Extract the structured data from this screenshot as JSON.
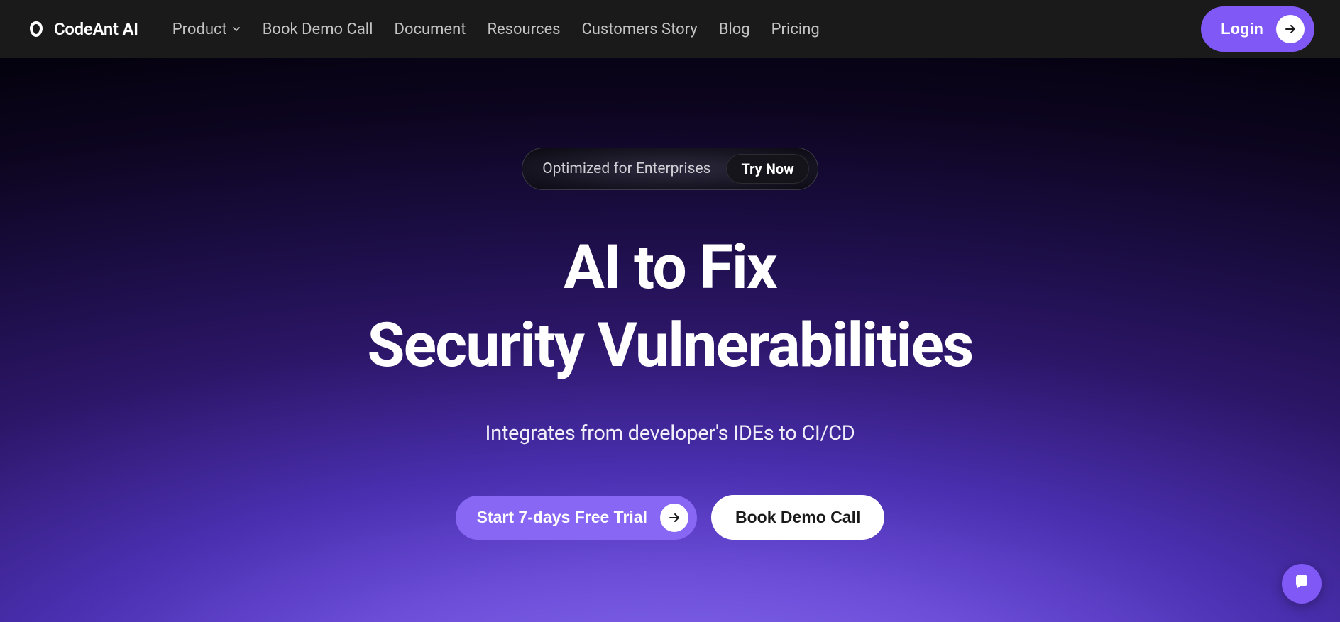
{
  "brand": {
    "name": "CodeAnt AI"
  },
  "nav": {
    "items": [
      {
        "label": "Product",
        "hasDropdown": true
      },
      {
        "label": "Book Demo Call",
        "hasDropdown": false
      },
      {
        "label": "Document",
        "hasDropdown": false
      },
      {
        "label": "Resources",
        "hasDropdown": false
      },
      {
        "label": "Customers Story",
        "hasDropdown": false
      },
      {
        "label": "Blog",
        "hasDropdown": false
      },
      {
        "label": "Pricing",
        "hasDropdown": false
      }
    ],
    "login_label": "Login"
  },
  "hero": {
    "pill_text": "Optimized for Enterprises",
    "pill_cta": "Try Now",
    "headline_line1": "AI to Fix",
    "headline_line2": "Security Vulnerabilities",
    "subhead": "Integrates from developer's IDEs to CI/CD",
    "cta_primary": "Start 7-days Free Trial",
    "cta_secondary": "Book Demo Call"
  },
  "colors": {
    "accent": "#8058f5",
    "nav_bg": "#1a1a1a",
    "text_light": "#ffffff"
  }
}
